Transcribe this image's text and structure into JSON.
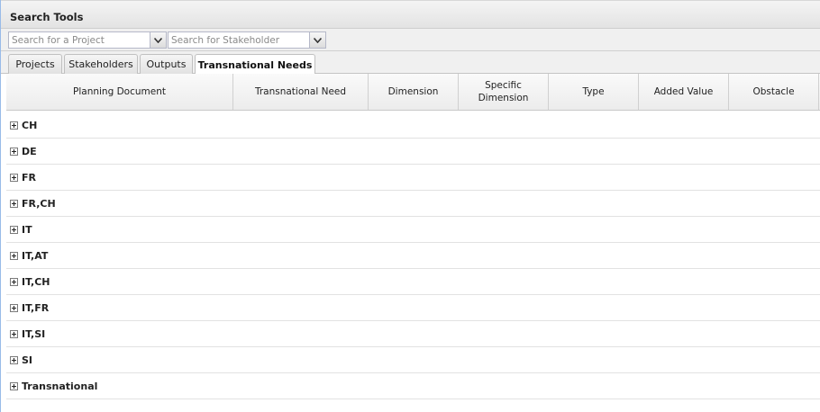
{
  "panel": {
    "title": "Search Tools"
  },
  "search": {
    "project_placeholder": "Search for a Project",
    "stakeholder_placeholder": "Search for Stakeholder"
  },
  "tabs": [
    {
      "label": "Projects",
      "active": false
    },
    {
      "label": "Stakeholders",
      "active": false
    },
    {
      "label": "Outputs",
      "active": false
    },
    {
      "label": "Transnational Needs",
      "active": true
    }
  ],
  "grid": {
    "columns": [
      "Planning Document",
      "Transnational Need",
      "Dimension",
      "Specific Dimension",
      "Type",
      "Added Value",
      "Obstacle"
    ],
    "groups": [
      "CH",
      "DE",
      "FR",
      "FR,CH",
      "IT",
      "IT,AT",
      "IT,CH",
      "IT,FR",
      "IT,SI",
      "SI",
      "Transnational"
    ]
  },
  "icons": {
    "dropdown": "chevron-down-icon",
    "expand": "plus-box-icon"
  }
}
